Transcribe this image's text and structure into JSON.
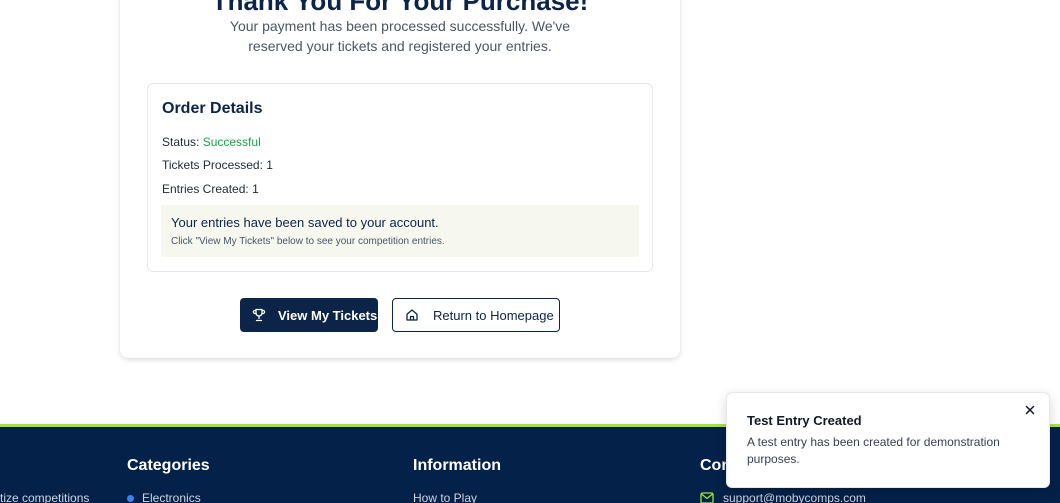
{
  "confirmation": {
    "headline": "Thank You For Your Purchase!",
    "subtitle": "Your payment has been processed successfully. We've reserved your tickets and registered your entries."
  },
  "order": {
    "title": "Order Details",
    "status_label": "Status:",
    "status_value": "Successful",
    "tickets_label": "Tickets Processed:",
    "tickets_value": "1",
    "entries_label": "Entries Created:",
    "entries_value": "1",
    "note_main": "Your entries have been saved to your account.",
    "note_sub": "Click \"View My Tickets\" below to see your competition entries."
  },
  "actions": {
    "view_tickets": "View My Tickets",
    "return_home": "Return to Homepage"
  },
  "footer": {
    "left_text": "tize competitions",
    "categories_heading": "Categories",
    "categories_first": "Electronics",
    "information_heading": "Information",
    "information_first": "How to Play",
    "contact_heading": "Con",
    "contact_email": "support@mobycomps.com"
  },
  "toast": {
    "title": "Test Entry Created",
    "body": "A test entry has been created for demonstration purposes."
  },
  "colors": {
    "navy": "#0c2447",
    "success": "#16a34a",
    "accent_line": "#a3e635",
    "footer_bg": "#04214a"
  },
  "icons": {
    "view_tickets": "trophy-icon",
    "return_home": "home-icon",
    "toast_close": "close-icon",
    "email": "mail-icon"
  }
}
